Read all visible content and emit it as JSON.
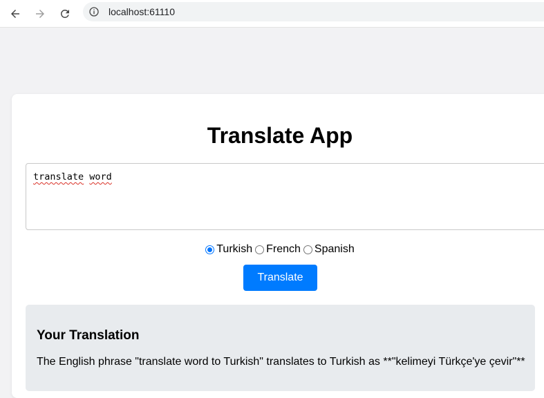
{
  "browser": {
    "url": "localhost:61110"
  },
  "app": {
    "title": "Translate App",
    "input_value_part1": "translate",
    "input_value_part2": "word",
    "languages": [
      {
        "label": "Turkish",
        "selected": true
      },
      {
        "label": "French",
        "selected": false
      },
      {
        "label": "Spanish",
        "selected": false
      }
    ],
    "translate_label": "Translate",
    "result_heading": "Your Translation",
    "result_text": "The English phrase \"translate word to Turkish\" translates to Turkish as **\"kelimeyi Türkçe'ye çevir\"**"
  },
  "colors": {
    "accent": "#007bff",
    "radio_accent": "#0075ff",
    "result_bg": "#e8ebee",
    "page_bg": "#f2f2f4"
  },
  "icons": [
    "back-arrow-icon",
    "forward-arrow-icon",
    "reload-icon",
    "site-info-icon"
  ]
}
